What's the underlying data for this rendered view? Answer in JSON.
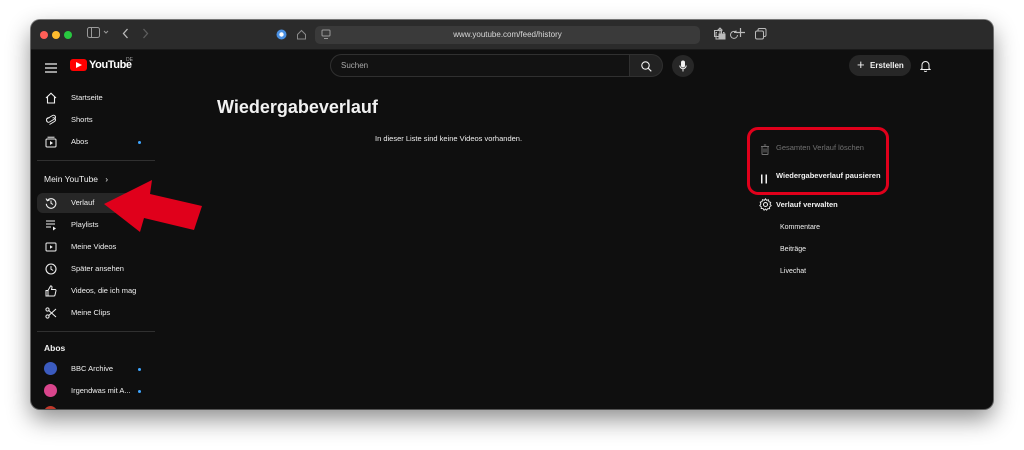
{
  "browser": {
    "url": "www.youtube.com/feed/history"
  },
  "masthead": {
    "logo_text": "YouTube",
    "country_code": "DE",
    "search_placeholder": "Suchen",
    "create_label": "Erstellen"
  },
  "sidebar": {
    "main": [
      {
        "label": "Startseite",
        "icon": "home-icon"
      },
      {
        "label": "Shorts",
        "icon": "shorts-icon"
      },
      {
        "label": "Abos",
        "icon": "subscriptions-icon"
      }
    ],
    "you_title": "Mein YouTube",
    "you_items": [
      {
        "label": "Verlauf",
        "icon": "history-icon"
      },
      {
        "label": "Playlists",
        "icon": "playlists-icon"
      },
      {
        "label": "Meine Videos",
        "icon": "my-videos-icon"
      },
      {
        "label": "Später ansehen",
        "icon": "watch-later-icon"
      },
      {
        "label": "Videos, die ich mag",
        "icon": "like-icon"
      },
      {
        "label": "Meine Clips",
        "icon": "clips-icon"
      }
    ],
    "subs_title": "Abos",
    "subs": [
      {
        "label": "BBC Archive",
        "color": "#3b5bbf"
      },
      {
        "label": "Irgendwas mit A...",
        "color": "#d9458c"
      }
    ]
  },
  "main": {
    "title": "Wiedergabeverlauf",
    "empty_message": "In dieser Liste sind keine Videos vorhanden."
  },
  "history_panel": {
    "clear_all": "Gesamten Verlauf löschen",
    "pause": "Wiedergabeverlauf pausieren",
    "manage": "Verlauf verwalten",
    "sub_items": [
      "Kommentare",
      "Beiträge",
      "Livechat"
    ]
  },
  "colors": {
    "background": "#0f0f0f",
    "accent": "#ff0000",
    "annotation": "#e0001b",
    "badge_dot": "#3ea6ff"
  }
}
